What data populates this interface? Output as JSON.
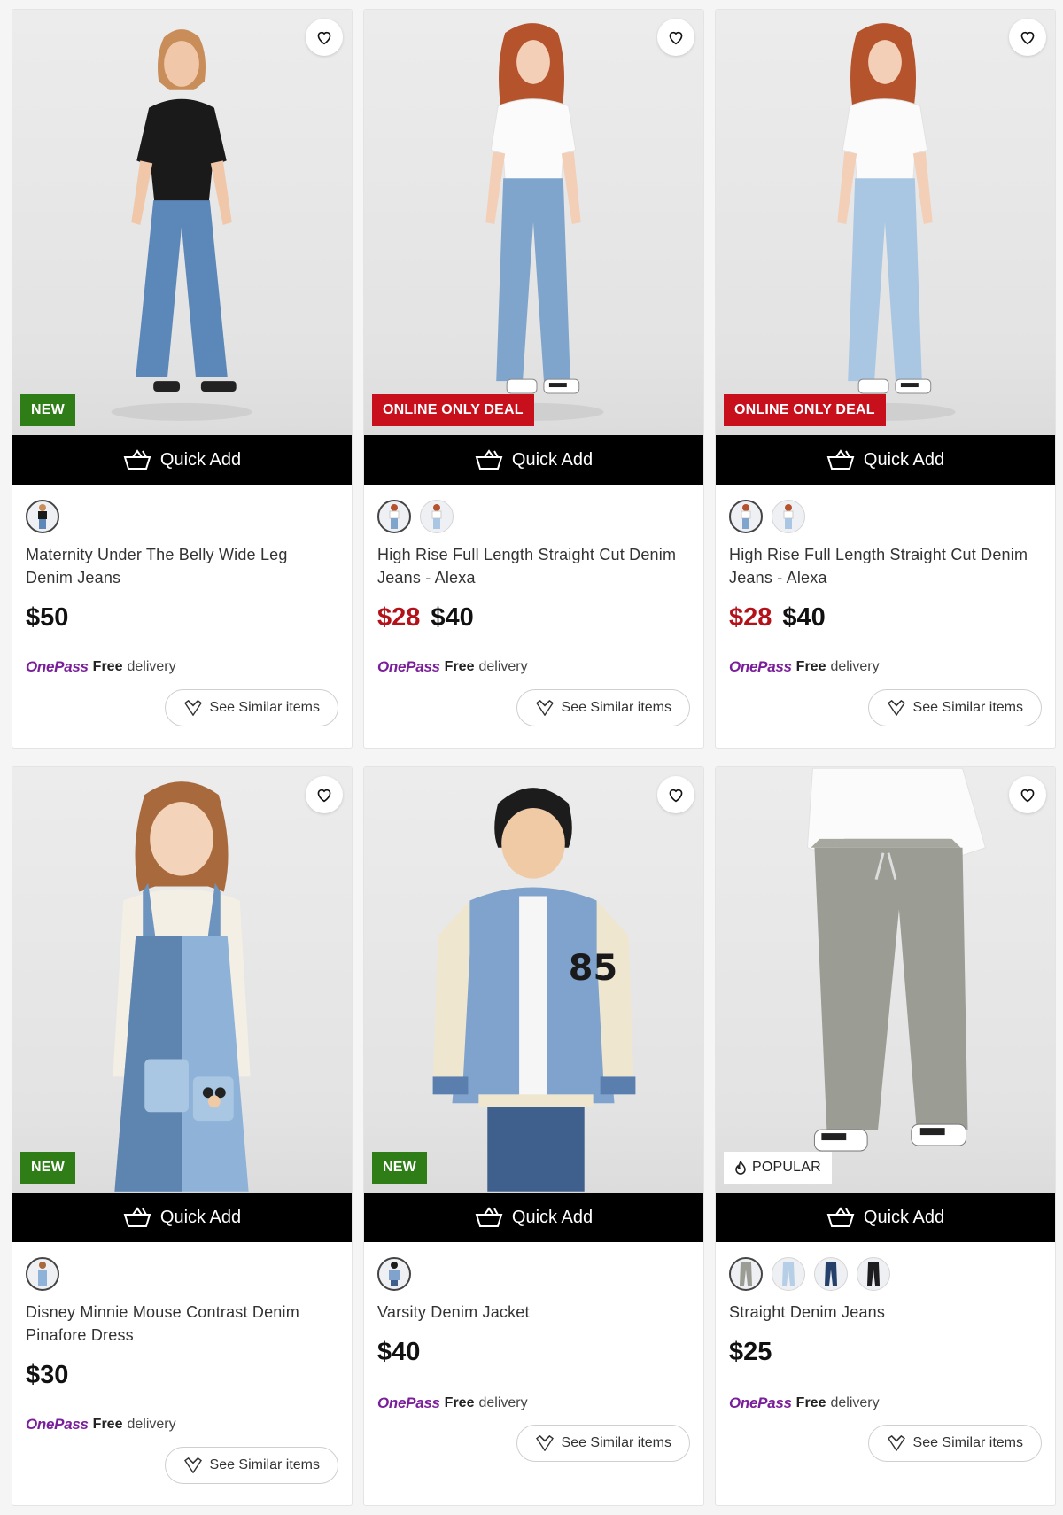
{
  "quick_add_label": "Quick Add",
  "see_similar_label": "See Similar items",
  "onepass": {
    "logo": "OnePass",
    "free": "Free",
    "delivery": "delivery"
  },
  "products": [
    {
      "name": "Maternity Under The Belly Wide Leg Denim Jeans",
      "price": "$50",
      "sale_price": "",
      "badge": "NEW",
      "badge_style": "green",
      "swatches": [
        "black-top"
      ],
      "selected_swatch": 0
    },
    {
      "name": "High Rise Full Length Straight Cut Denim Jeans - Alexa",
      "price": "$40",
      "sale_price": "$28",
      "badge": "ONLINE ONLY DEAL",
      "badge_style": "red",
      "swatches": [
        "mid-blue",
        "light-blue"
      ],
      "selected_swatch": 0
    },
    {
      "name": "High Rise Full Length Straight Cut Denim Jeans - Alexa",
      "price": "$40",
      "sale_price": "$28",
      "badge": "ONLINE ONLY DEAL",
      "badge_style": "red",
      "swatches": [
        "mid-blue",
        "light-blue"
      ],
      "selected_swatch": 0
    },
    {
      "name": "Disney Minnie Mouse Contrast Denim Pinafore Dress",
      "price": "$30",
      "sale_price": "",
      "badge": "NEW",
      "badge_style": "green",
      "swatches": [
        "denim-dress"
      ],
      "selected_swatch": 0
    },
    {
      "name": "Varsity Denim Jacket",
      "price": "$40",
      "sale_price": "",
      "badge": "NEW",
      "badge_style": "green",
      "swatches": [
        "blue-jacket"
      ],
      "selected_swatch": 0
    },
    {
      "name": "Straight Denim Jeans",
      "price": "$25",
      "sale_price": "",
      "badge": "POPULAR",
      "badge_style": "white",
      "swatches": [
        "grey",
        "light-blue",
        "dark-blue",
        "black"
      ],
      "selected_swatch": 0
    }
  ]
}
